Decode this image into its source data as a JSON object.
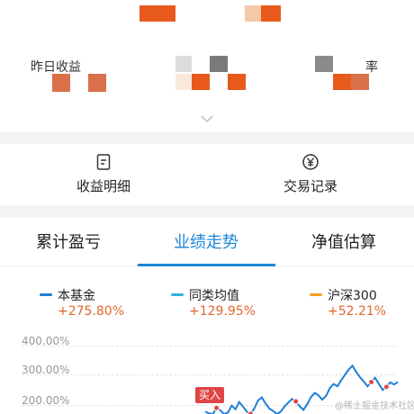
{
  "summary": {
    "partial_left": "昨日收益",
    "partial_right": "率"
  },
  "actions": [
    {
      "label": "收益明细",
      "icon": "document-icon"
    },
    {
      "label": "交易记录",
      "icon": "yen-circle-icon"
    }
  ],
  "tabs": [
    {
      "label": "累计盈亏",
      "active": false
    },
    {
      "label": "业绩走势",
      "active": true
    },
    {
      "label": "净值估算",
      "active": false
    }
  ],
  "legend": [
    {
      "name": "本基金",
      "value": "+275.80%",
      "color": "#1c7fd8"
    },
    {
      "name": "同类均值",
      "value": "+129.95%",
      "color": "#2bb5d8"
    },
    {
      "name": "沪深300",
      "value": "+52.21%",
      "color": "#f0a020"
    }
  ],
  "chart_data": {
    "type": "line",
    "y_ticks": [
      "400.00%",
      "300.00%",
      "200.00%"
    ],
    "ylim": [
      100,
      420
    ],
    "series": [
      {
        "name": "本基金",
        "color": "#1c7fd8",
        "values": [
          178,
          172,
          165,
          190,
          182,
          168,
          175,
          198,
          186,
          210,
          195,
          178,
          170,
          188,
          215,
          225,
          205,
          188,
          180,
          170,
          178,
          195,
          208,
          220,
          212,
          196,
          184,
          202,
          226,
          240,
          232,
          218,
          230,
          256,
          270,
          262,
          282,
          300,
          318,
          330,
          310,
          292,
          278,
          262,
          276,
          290,
          270,
          250,
          260,
          275,
          268,
          276
        ]
      }
    ],
    "annotations": [
      "买入"
    ]
  },
  "watermark": "@稀土掘金技术社区",
  "colors": {
    "accent": "#1c86d7",
    "up": "#e0662e",
    "buy": "#e04646"
  }
}
